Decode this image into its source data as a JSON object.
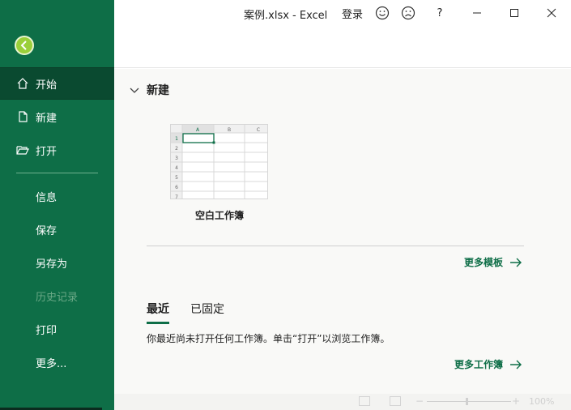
{
  "window": {
    "title": "案例.xlsx  -  Excel",
    "signin": "登录",
    "help": "?",
    "smile_icon": "smiley-face-icon",
    "frown_icon": "frown-face-icon"
  },
  "sidebar": {
    "back_icon": "back-arrow-icon",
    "top_items": [
      {
        "label": "开始",
        "icon": "home-icon",
        "active": true
      },
      {
        "label": "新建",
        "icon": "new-document-icon"
      },
      {
        "label": "打开",
        "icon": "open-folder-icon"
      }
    ],
    "bottom_items": [
      {
        "label": "信息"
      },
      {
        "label": "保存"
      },
      {
        "label": "另存为"
      },
      {
        "label": "历史记录",
        "disabled": true
      },
      {
        "label": "打印"
      },
      {
        "label": "更多..."
      }
    ]
  },
  "new_section": {
    "heading": "新建",
    "blank_workbook": "空白工作簿",
    "sheet_columns": [
      "A",
      "B",
      "C"
    ],
    "sheet_rows": [
      "1",
      "2",
      "3",
      "4",
      "5",
      "6",
      "7"
    ],
    "more_templates": "更多模板"
  },
  "recent_section": {
    "tabs": [
      {
        "label": "最近",
        "active": true
      },
      {
        "label": "已固定"
      }
    ],
    "empty_message": "你最近尚未打开任何工作簿。单击“打开”以浏览工作簿。",
    "more_workbooks": "更多工作簿"
  },
  "status": {
    "zoom": "100%"
  },
  "colors": {
    "brand": "#0e6e47",
    "sidebar_active": "#0a4a30"
  }
}
